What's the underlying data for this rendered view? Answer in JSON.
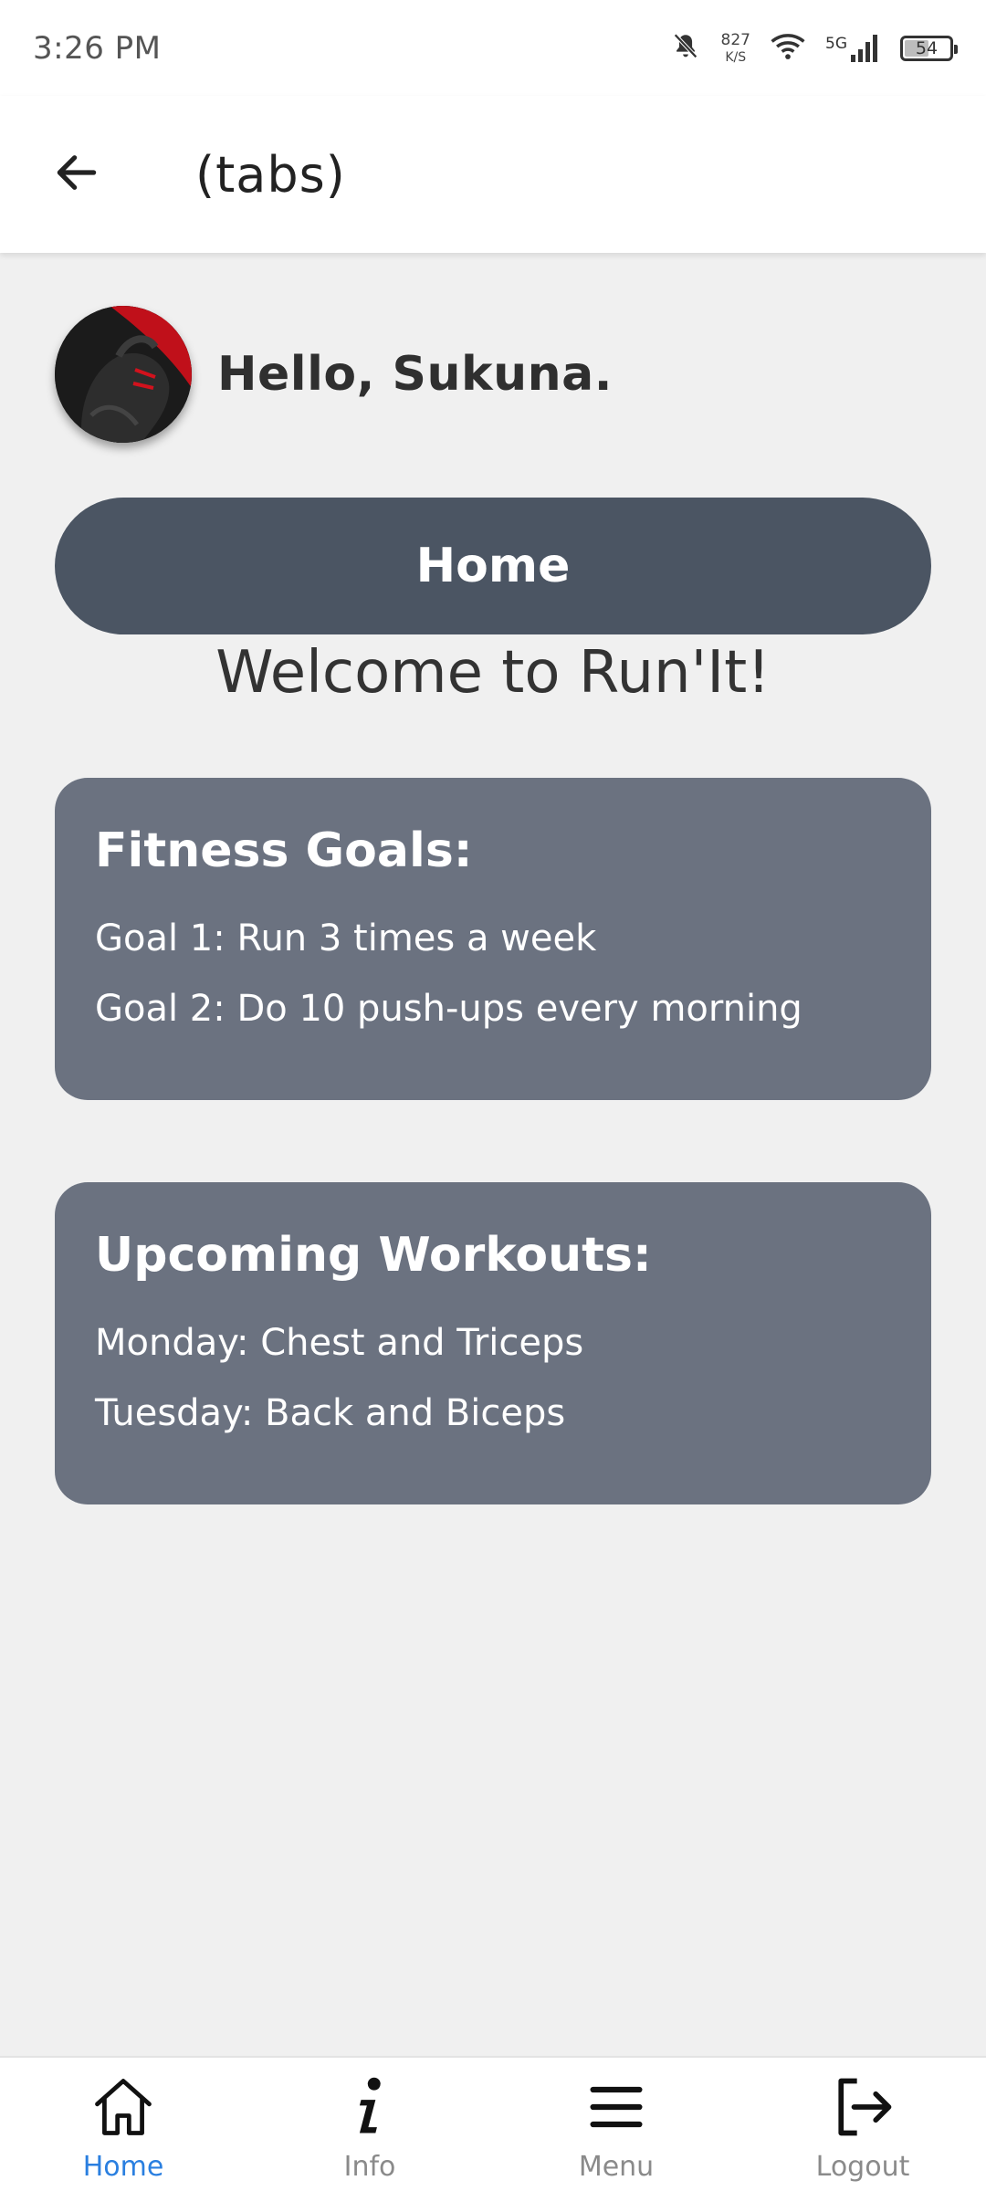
{
  "status_bar": {
    "time": "3:26 PM",
    "net_speed_value": "827",
    "net_speed_unit": "K/S",
    "network_type": "5G",
    "battery_level": "54",
    "icons": [
      "bell-muted-icon",
      "wifi-icon",
      "signal-icon",
      "battery-icon"
    ]
  },
  "header": {
    "title": "(tabs)",
    "back_icon": "arrow-left-icon"
  },
  "greeting": {
    "text": "Hello, Sukuna."
  },
  "home_button": {
    "label": "Home"
  },
  "welcome_text": "Welcome to Run'It!",
  "fitness_goals": {
    "title": "Fitness Goals:",
    "items": [
      "Goal 1: Run 3 times a week",
      "Goal 2: Do 10 push-ups every morning"
    ]
  },
  "upcoming_workouts": {
    "title": "Upcoming Workouts:",
    "items": [
      "Monday: Chest and Triceps",
      "Tuesday: Back and Biceps"
    ]
  },
  "bottom_nav": {
    "items": [
      {
        "label": "Home",
        "icon": "home-icon",
        "active": true
      },
      {
        "label": "Info",
        "icon": "info-icon",
        "active": false
      },
      {
        "label": "Menu",
        "icon": "menu-icon",
        "active": false
      },
      {
        "label": "Logout",
        "icon": "logout-icon",
        "active": false
      }
    ]
  },
  "colors": {
    "background": "#f0f0f0",
    "pill": "#4b5563",
    "card": "#6b7280",
    "active_nav": "#2a7fe0",
    "inactive_nav": "#8a8a8a"
  }
}
